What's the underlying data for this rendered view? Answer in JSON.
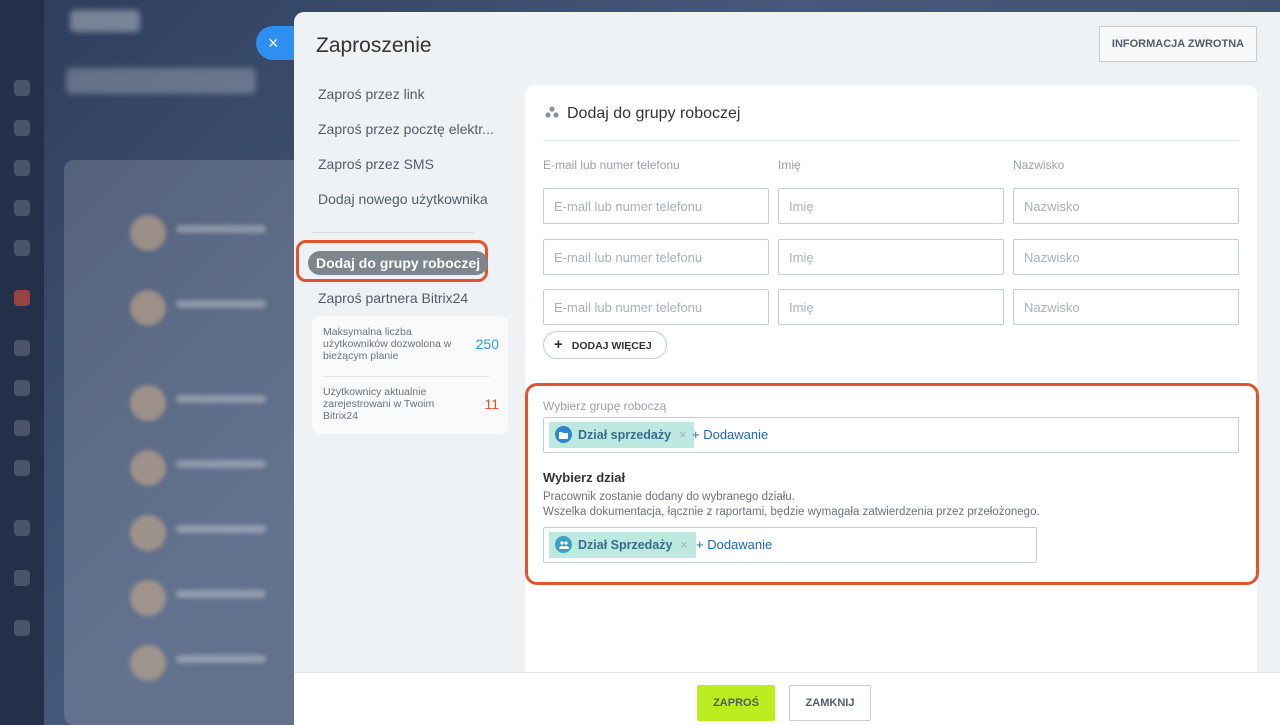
{
  "dialog": {
    "title": "Zaproszenie",
    "feedback_label": "INFORMACJA ZWROTNA",
    "close_symbol": "×"
  },
  "menu": {
    "items": [
      "Zaproś przez link",
      "Zaproś przez pocztę elektr...",
      "Zaproś przez SMS",
      "Dodaj nowego użytkownika"
    ],
    "active": "Dodaj do grupy roboczej",
    "partner": "Zaproś partnera Bitrix24"
  },
  "limits": {
    "max_label": "Maksymalna liczba użytkowników dozwolona w bieżącym planie",
    "max_value": "250",
    "current_label": "Użytkownicy aktualnie zarejestrowani w Twoim Bitrix24",
    "current_value": "11"
  },
  "form": {
    "heading": "Dodaj do grupy roboczej",
    "heading_icon": "group-icon",
    "col_email": "E-mail lub numer telefonu",
    "col_name": "Imię",
    "col_surname": "Nazwisko",
    "ph_email": "E-mail lub numer telefonu",
    "ph_name": "Imię",
    "ph_surname": "Nazwisko",
    "add_more": "DODAJ WIĘCEJ",
    "group_label": "Wybierz grupę roboczą",
    "group_tag": "Dział sprzedaży",
    "add_label": "+ Dodawanie",
    "dept_title": "Wybierz dział",
    "dept_desc_1": "Pracownik zostanie dodany do wybranego działu.",
    "dept_desc_2": "Wszelka dokumentacja, łącznie z raportami, będzie wymagała zatwierdzenia przez przełożonego.",
    "dept_tag": "Dział Sprzedaży"
  },
  "footer": {
    "invite": "ZAPROŚ",
    "close": "ZAMKNIJ"
  },
  "colors": {
    "accent_green": "#bbed21",
    "highlight": "#e2542b",
    "tag_bg": "#bde9e1",
    "link": "#2067b0",
    "limit_max": "#2fa0d6",
    "limit_current": "#e2542b"
  }
}
